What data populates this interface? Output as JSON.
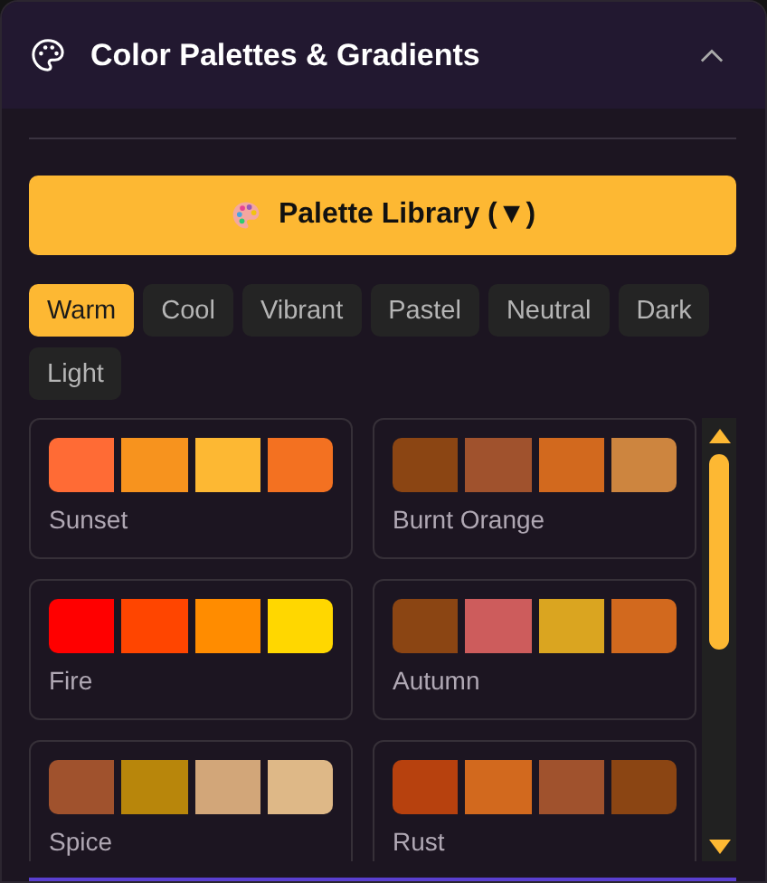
{
  "panel": {
    "title": "Color Palettes & Gradients",
    "expanded": true
  },
  "library_button": {
    "label": "Palette Library (▼)"
  },
  "categories": [
    {
      "label": "Warm",
      "selected": true
    },
    {
      "label": "Cool",
      "selected": false
    },
    {
      "label": "Vibrant",
      "selected": false
    },
    {
      "label": "Pastel",
      "selected": false
    },
    {
      "label": "Neutral",
      "selected": false
    },
    {
      "label": "Dark",
      "selected": false
    },
    {
      "label": "Light",
      "selected": false
    }
  ],
  "palettes": [
    {
      "name": "Sunset",
      "swatches": [
        {
          "color": "#ff6b35"
        },
        {
          "color": "#f7931e"
        },
        {
          "color": "#fdb833"
        },
        {
          "color": "#f37121"
        }
      ]
    },
    {
      "name": "Burnt Orange",
      "swatches": [
        {
          "color": "#8b4513"
        },
        {
          "color": "#a0522d"
        },
        {
          "color": "#d2691e"
        },
        {
          "color": "#cd853f"
        }
      ]
    },
    {
      "name": "Fire",
      "swatches": [
        {
          "color": "#ff0000"
        },
        {
          "color": "#ff4500"
        },
        {
          "color": "#ff8c00"
        },
        {
          "color": "#ffd700"
        }
      ]
    },
    {
      "name": "Autumn",
      "swatches": [
        {
          "color": "#8b4513"
        },
        {
          "color": "#cd5c5c"
        },
        {
          "color": "#daa520"
        },
        {
          "color": "#d2691e"
        }
      ]
    },
    {
      "name": "Spice",
      "swatches": [
        {
          "color": "#a0522d"
        },
        {
          "color": "#b8860b"
        },
        {
          "color": "#d2a679"
        },
        {
          "color": "#deb887"
        }
      ]
    },
    {
      "name": "Rust",
      "swatches": [
        {
          "color": "#b7410e"
        },
        {
          "color": "#d2691e"
        },
        {
          "color": "#a0522d"
        },
        {
          "color": "#8b4513"
        }
      ]
    }
  ]
}
